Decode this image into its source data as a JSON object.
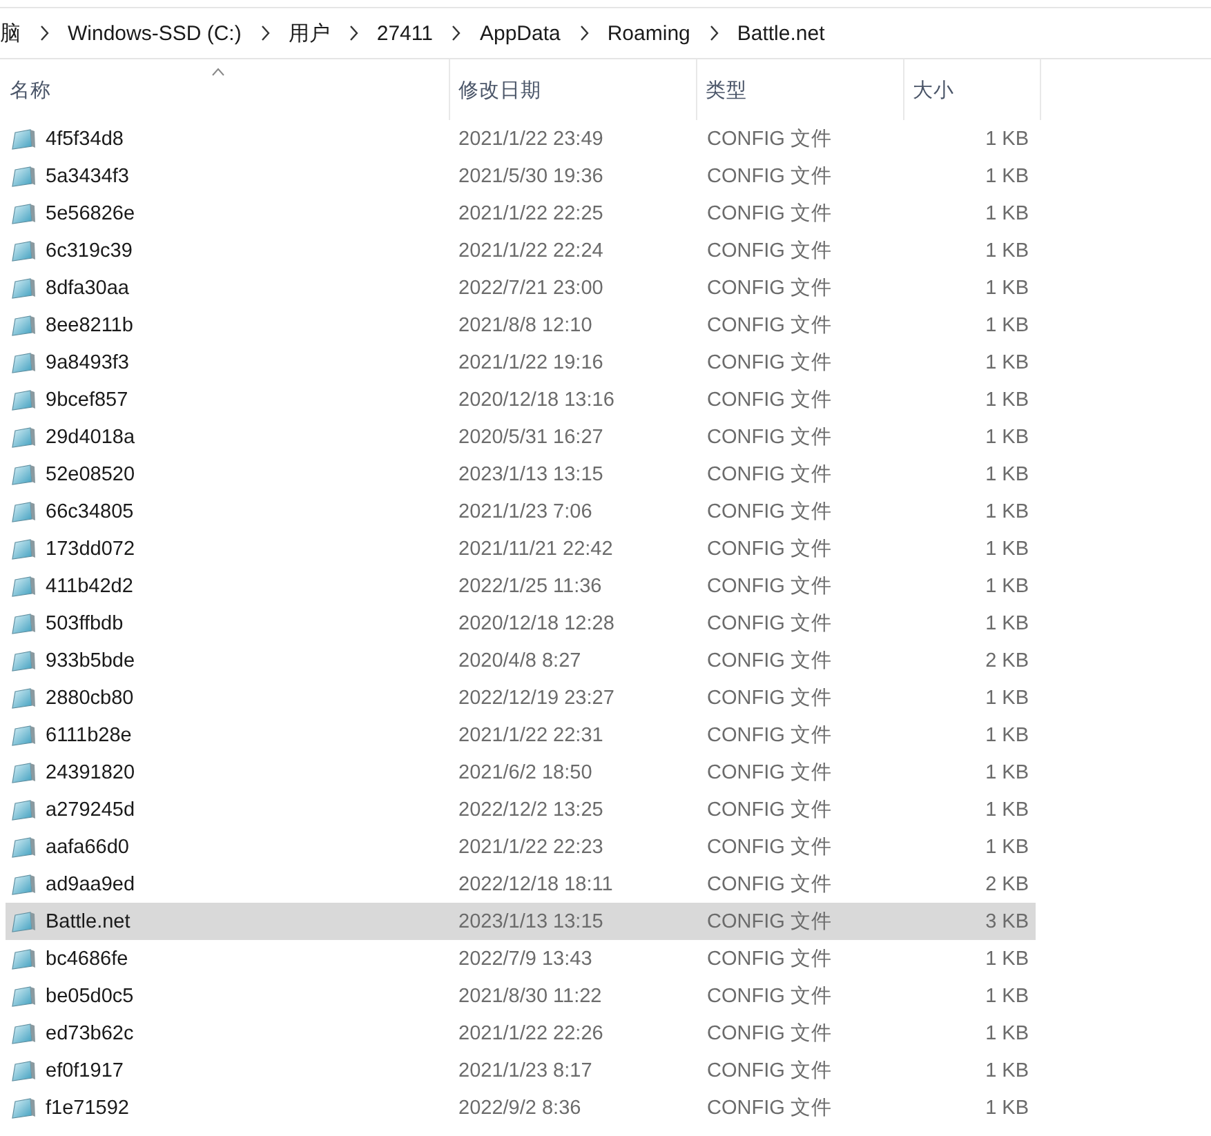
{
  "breadcrumb": [
    "脑",
    "Windows-SSD (C:)",
    "用户",
    "27411",
    "AppData",
    "Roaming",
    "Battle.net"
  ],
  "columns": [
    {
      "label": "名称",
      "sorted": true
    },
    {
      "label": "修改日期",
      "sorted": false
    },
    {
      "label": "类型",
      "sorted": false
    },
    {
      "label": "大小",
      "sorted": false
    }
  ],
  "rows": [
    {
      "name": "4f5f34d8",
      "modified": "2021/1/22 23:49",
      "type": "CONFIG 文件",
      "size": "1 KB",
      "selected": false
    },
    {
      "name": "5a3434f3",
      "modified": "2021/5/30 19:36",
      "type": "CONFIG 文件",
      "size": "1 KB",
      "selected": false
    },
    {
      "name": "5e56826e",
      "modified": "2021/1/22 22:25",
      "type": "CONFIG 文件",
      "size": "1 KB",
      "selected": false
    },
    {
      "name": "6c319c39",
      "modified": "2021/1/22 22:24",
      "type": "CONFIG 文件",
      "size": "1 KB",
      "selected": false
    },
    {
      "name": "8dfa30aa",
      "modified": "2022/7/21 23:00",
      "type": "CONFIG 文件",
      "size": "1 KB",
      "selected": false
    },
    {
      "name": "8ee8211b",
      "modified": "2021/8/8 12:10",
      "type": "CONFIG 文件",
      "size": "1 KB",
      "selected": false
    },
    {
      "name": "9a8493f3",
      "modified": "2021/1/22 19:16",
      "type": "CONFIG 文件",
      "size": "1 KB",
      "selected": false
    },
    {
      "name": "9bcef857",
      "modified": "2020/12/18 13:16",
      "type": "CONFIG 文件",
      "size": "1 KB",
      "selected": false
    },
    {
      "name": "29d4018a",
      "modified": "2020/5/31 16:27",
      "type": "CONFIG 文件",
      "size": "1 KB",
      "selected": false
    },
    {
      "name": "52e08520",
      "modified": "2023/1/13 13:15",
      "type": "CONFIG 文件",
      "size": "1 KB",
      "selected": false
    },
    {
      "name": "66c34805",
      "modified": "2021/1/23 7:06",
      "type": "CONFIG 文件",
      "size": "1 KB",
      "selected": false
    },
    {
      "name": "173dd072",
      "modified": "2021/11/21 22:42",
      "type": "CONFIG 文件",
      "size": "1 KB",
      "selected": false
    },
    {
      "name": "411b42d2",
      "modified": "2022/1/25 11:36",
      "type": "CONFIG 文件",
      "size": "1 KB",
      "selected": false
    },
    {
      "name": "503ffbdb",
      "modified": "2020/12/18 12:28",
      "type": "CONFIG 文件",
      "size": "1 KB",
      "selected": false
    },
    {
      "name": "933b5bde",
      "modified": "2020/4/8 8:27",
      "type": "CONFIG 文件",
      "size": "2 KB",
      "selected": false
    },
    {
      "name": "2880cb80",
      "modified": "2022/12/19 23:27",
      "type": "CONFIG 文件",
      "size": "1 KB",
      "selected": false
    },
    {
      "name": "6111b28e",
      "modified": "2021/1/22 22:31",
      "type": "CONFIG 文件",
      "size": "1 KB",
      "selected": false
    },
    {
      "name": "24391820",
      "modified": "2021/6/2 18:50",
      "type": "CONFIG 文件",
      "size": "1 KB",
      "selected": false
    },
    {
      "name": "a279245d",
      "modified": "2022/12/2 13:25",
      "type": "CONFIG 文件",
      "size": "1 KB",
      "selected": false
    },
    {
      "name": "aafa66d0",
      "modified": "2021/1/22 22:23",
      "type": "CONFIG 文件",
      "size": "1 KB",
      "selected": false
    },
    {
      "name": "ad9aa9ed",
      "modified": "2022/12/18 18:11",
      "type": "CONFIG 文件",
      "size": "2 KB",
      "selected": false
    },
    {
      "name": "Battle.net",
      "modified": "2023/1/13 13:15",
      "type": "CONFIG 文件",
      "size": "3 KB",
      "selected": true
    },
    {
      "name": "bc4686fe",
      "modified": "2022/7/9 13:43",
      "type": "CONFIG 文件",
      "size": "1 KB",
      "selected": false
    },
    {
      "name": "be05d0c5",
      "modified": "2021/8/30 11:22",
      "type": "CONFIG 文件",
      "size": "1 KB",
      "selected": false
    },
    {
      "name": "ed73b62c",
      "modified": "2021/1/22 22:26",
      "type": "CONFIG 文件",
      "size": "1 KB",
      "selected": false
    },
    {
      "name": "ef0f1917",
      "modified": "2021/1/23 8:17",
      "type": "CONFIG 文件",
      "size": "1 KB",
      "selected": false
    },
    {
      "name": "f1e71592",
      "modified": "2022/9/2 8:36",
      "type": "CONFIG 文件",
      "size": "1 KB",
      "selected": false
    }
  ]
}
